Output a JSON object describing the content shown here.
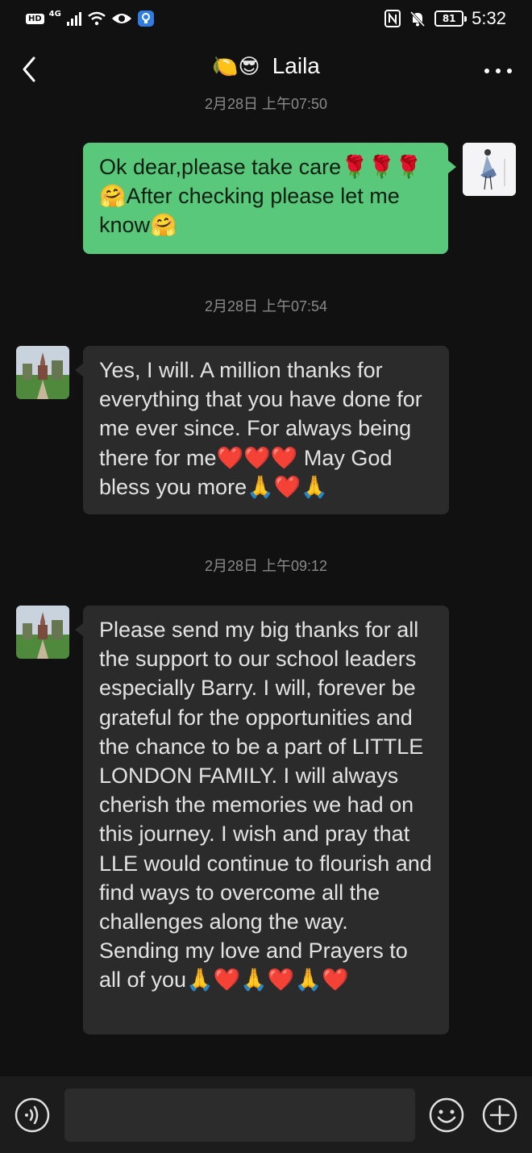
{
  "status_bar": {
    "hd": "HD",
    "network": "4G",
    "battery": "81",
    "time": "5:32"
  },
  "header": {
    "title_emoji": "🍋😎",
    "title": "Laila"
  },
  "messages": [
    {
      "type": "timestamp",
      "text": "2月28日 上午07:50"
    },
    {
      "type": "sent",
      "text": "Ok dear,please take care🌹🌹🌹🤗After checking please let me know🤗"
    },
    {
      "type": "timestamp",
      "text": "2月28日 上午07:54"
    },
    {
      "type": "received",
      "text": "Yes, I will. A million thanks for everything that you have done for me ever since. For always being there for me❤️❤️❤️ May God bless you more🙏❤️🙏"
    },
    {
      "type": "timestamp",
      "text": "2月28日 上午09:12"
    },
    {
      "type": "received",
      "text": "Please send my big thanks for all the support to our school leaders especially Barry. I will, forever be grateful for the opportunities and the chance to be a part of LITTLE LONDON FAMILY. I will always cherish the memories we had on this journey. I wish and pray that LLE would continue to flourish and find ways to overcome all the challenges along the way. Sending my love and Prayers to all of you🙏❤️🙏❤️🙏❤️"
    }
  ],
  "input": {
    "value": ""
  },
  "icons": {
    "back": "chevron-left-icon",
    "more": "more-dots-icon",
    "voice": "voice-icon",
    "emoji": "emoji-icon",
    "plus": "plus-icon"
  },
  "colors": {
    "background": "#111111",
    "sent_bubble": "#5ac87a",
    "received_bubble": "#2b2b2b",
    "timestamp": "#8a8a8a"
  }
}
